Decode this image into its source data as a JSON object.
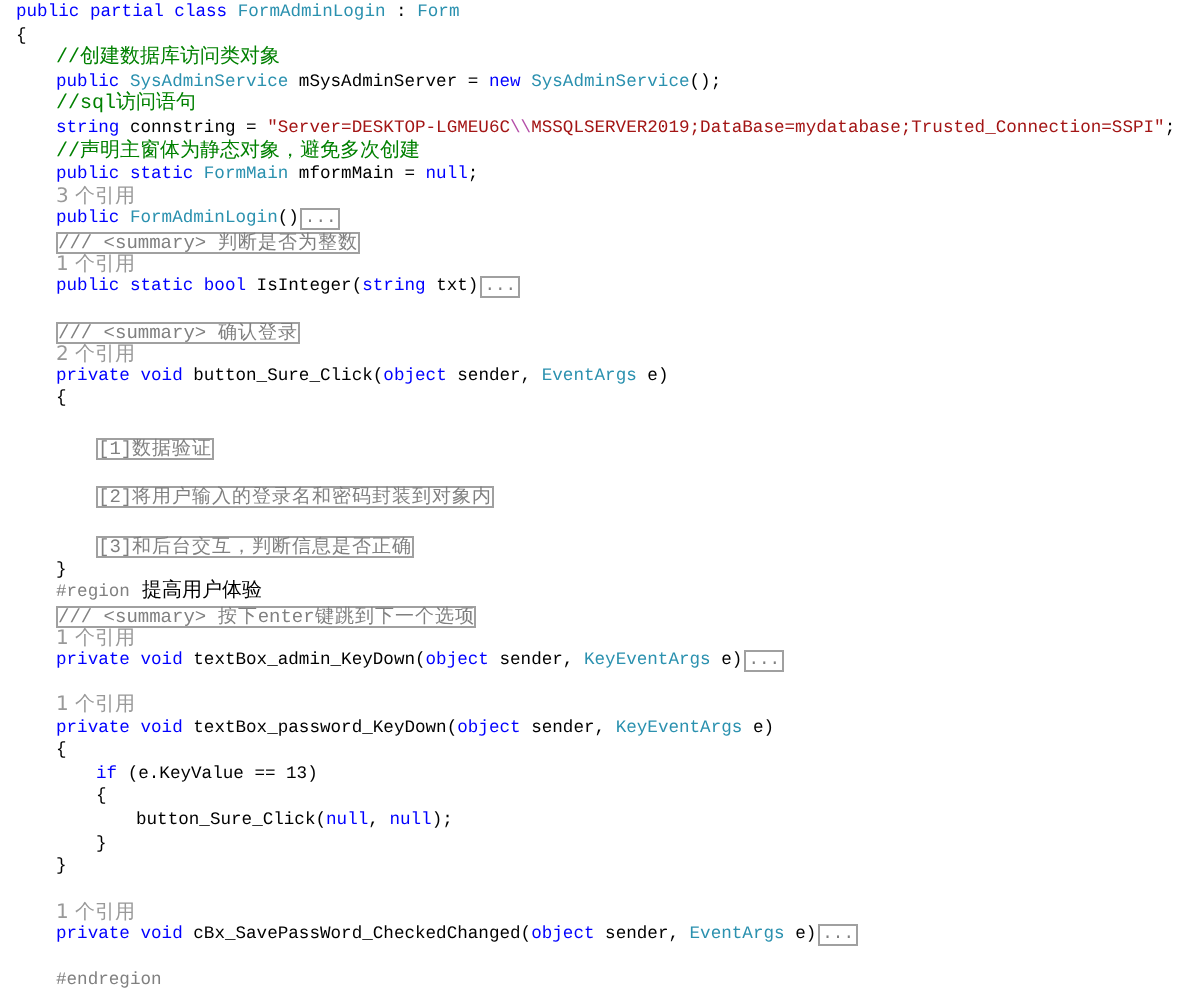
{
  "lines": [
    {
      "kind": "code",
      "tokens": [
        {
          "kind": "keyword",
          "text": "public partial class "
        },
        {
          "kind": "type",
          "text": "FormAdminLogin"
        },
        {
          "kind": "plain",
          "text": " : "
        },
        {
          "kind": "type",
          "text": "Form"
        }
      ]
    },
    {
      "kind": "code",
      "tokens": [
        {
          "kind": "plain",
          "text": "{"
        }
      ]
    },
    {
      "kind": "block",
      "children": [
        {
          "kind": "code",
          "tokens": [
            {
              "kind": "comment",
              "text": "//创建数据库访问类对象"
            }
          ]
        },
        {
          "kind": "code",
          "tokens": [
            {
              "kind": "keyword",
              "text": "public "
            },
            {
              "kind": "type",
              "text": "SysAdminService"
            },
            {
              "kind": "plain",
              "text": " mSysAdminServer = "
            },
            {
              "kind": "keyword",
              "text": "new "
            },
            {
              "kind": "type",
              "text": "SysAdminService"
            },
            {
              "kind": "plain",
              "text": "();"
            }
          ]
        },
        {
          "kind": "code",
          "tokens": [
            {
              "kind": "comment",
              "text": "//sql访问语句"
            }
          ]
        },
        {
          "kind": "code",
          "tokens": [
            {
              "kind": "keyword",
              "text": "string"
            },
            {
              "kind": "plain",
              "text": " connstring = "
            },
            {
              "kind": "string",
              "text": "\"Server=DESKTOP-LGMEU6C"
            },
            {
              "kind": "escape",
              "text": "\\\\"
            },
            {
              "kind": "string",
              "text": "MSSQLSERVER2019;DataBase=mydatabase;Trusted_Connection=SSPI\""
            },
            {
              "kind": "plain",
              "text": ";"
            }
          ]
        },
        {
          "kind": "code",
          "tokens": [
            {
              "kind": "comment",
              "text": "//声明主窗体为静态对象，避免多次创建"
            }
          ]
        },
        {
          "kind": "code",
          "tokens": [
            {
              "kind": "keyword",
              "text": "public static "
            },
            {
              "kind": "type",
              "text": "FormMain"
            },
            {
              "kind": "plain",
              "text": " mformMain = "
            },
            {
              "kind": "keyword",
              "text": "null"
            },
            {
              "kind": "plain",
              "text": ";"
            }
          ]
        },
        {
          "kind": "refs",
          "text": "3 个引用"
        },
        {
          "kind": "code",
          "tokens": [
            {
              "kind": "keyword",
              "text": "public "
            },
            {
              "kind": "type",
              "text": "FormAdminLogin"
            },
            {
              "kind": "plain",
              "text": "()"
            }
          ],
          "fold": "..."
        },
        {
          "kind": "doc",
          "text": "/// <summary> 判断是否为整数"
        },
        {
          "kind": "refs",
          "text": "1 个引用"
        },
        {
          "kind": "code",
          "tokens": [
            {
              "kind": "keyword",
              "text": "public static bool"
            },
            {
              "kind": "plain",
              "text": " IsInteger("
            },
            {
              "kind": "keyword",
              "text": "string"
            },
            {
              "kind": "plain",
              "text": " txt)"
            }
          ],
          "fold": "..."
        },
        {
          "kind": "blank"
        },
        {
          "kind": "doc",
          "text": "/// <summary> 确认登录"
        },
        {
          "kind": "refs",
          "text": "2 个引用"
        },
        {
          "kind": "code",
          "tokens": [
            {
              "kind": "keyword",
              "text": "private void"
            },
            {
              "kind": "plain",
              "text": " button_Sure_Click("
            },
            {
              "kind": "keyword",
              "text": "object"
            },
            {
              "kind": "plain",
              "text": " sender, "
            },
            {
              "kind": "type",
              "text": "EventArgs"
            },
            {
              "kind": "plain",
              "text": " e)"
            }
          ]
        },
        {
          "kind": "code",
          "tokens": [
            {
              "kind": "plain",
              "text": "{"
            }
          ]
        },
        {
          "kind": "block",
          "children": [
            {
              "kind": "blank"
            },
            {
              "kind": "note",
              "text": "[1]数据验证"
            },
            {
              "kind": "blank"
            },
            {
              "kind": "note",
              "text": "[2]将用户输入的登录名和密码封装到对象内"
            },
            {
              "kind": "blank"
            },
            {
              "kind": "note",
              "text": "[3]和后台交互，判断信息是否正确"
            }
          ]
        },
        {
          "kind": "code",
          "tokens": [
            {
              "kind": "plain",
              "text": "}"
            }
          ]
        },
        {
          "kind": "code",
          "tokens": [
            {
              "kind": "directive",
              "text": "#region"
            },
            {
              "kind": "label",
              "text": " 提高用户体验"
            }
          ]
        },
        {
          "kind": "doc",
          "text": "/// <summary> 按下enter键跳到下一个选项"
        },
        {
          "kind": "refs",
          "text": "1 个引用"
        },
        {
          "kind": "code",
          "tokens": [
            {
              "kind": "keyword",
              "text": "private void"
            },
            {
              "kind": "plain",
              "text": " textBox_admin_KeyDown("
            },
            {
              "kind": "keyword",
              "text": "object"
            },
            {
              "kind": "plain",
              "text": " sender, "
            },
            {
              "kind": "type",
              "text": "KeyEventArgs"
            },
            {
              "kind": "plain",
              "text": " e)"
            }
          ],
          "fold": "..."
        },
        {
          "kind": "blank"
        },
        {
          "kind": "refs",
          "text": "1 个引用"
        },
        {
          "kind": "code",
          "tokens": [
            {
              "kind": "keyword",
              "text": "private void"
            },
            {
              "kind": "plain",
              "text": " textBox_password_KeyDown("
            },
            {
              "kind": "keyword",
              "text": "object"
            },
            {
              "kind": "plain",
              "text": " sender, "
            },
            {
              "kind": "type",
              "text": "KeyEventArgs"
            },
            {
              "kind": "plain",
              "text": " e)"
            }
          ]
        },
        {
          "kind": "code",
          "tokens": [
            {
              "kind": "plain",
              "text": "{"
            }
          ]
        },
        {
          "kind": "block",
          "children": [
            {
              "kind": "code",
              "tokens": [
                {
                  "kind": "keyword",
                  "text": "if"
                },
                {
                  "kind": "plain",
                  "text": " (e.KeyValue == 13)"
                }
              ]
            },
            {
              "kind": "code",
              "tokens": [
                {
                  "kind": "plain",
                  "text": "{"
                }
              ]
            },
            {
              "kind": "block",
              "children": [
                {
                  "kind": "code",
                  "tokens": [
                    {
                      "kind": "plain",
                      "text": "button_Sure_Click("
                    },
                    {
                      "kind": "keyword",
                      "text": "null"
                    },
                    {
                      "kind": "plain",
                      "text": ", "
                    },
                    {
                      "kind": "keyword",
                      "text": "null"
                    },
                    {
                      "kind": "plain",
                      "text": ");"
                    }
                  ]
                }
              ]
            },
            {
              "kind": "code",
              "tokens": [
                {
                  "kind": "plain",
                  "text": "}"
                }
              ]
            }
          ]
        },
        {
          "kind": "code",
          "tokens": [
            {
              "kind": "plain",
              "text": "}"
            }
          ]
        },
        {
          "kind": "blank"
        },
        {
          "kind": "refs",
          "text": "1 个引用"
        },
        {
          "kind": "code",
          "tokens": [
            {
              "kind": "keyword",
              "text": "private void"
            },
            {
              "kind": "plain",
              "text": " cBx_SavePassWord_CheckedChanged("
            },
            {
              "kind": "keyword",
              "text": "object"
            },
            {
              "kind": "plain",
              "text": " sender, "
            },
            {
              "kind": "type",
              "text": "EventArgs"
            },
            {
              "kind": "plain",
              "text": " e)"
            }
          ],
          "fold": "..."
        },
        {
          "kind": "blank"
        },
        {
          "kind": "code",
          "tokens": [
            {
              "kind": "directive",
              "text": "#endregion"
            }
          ]
        }
      ]
    }
  ]
}
